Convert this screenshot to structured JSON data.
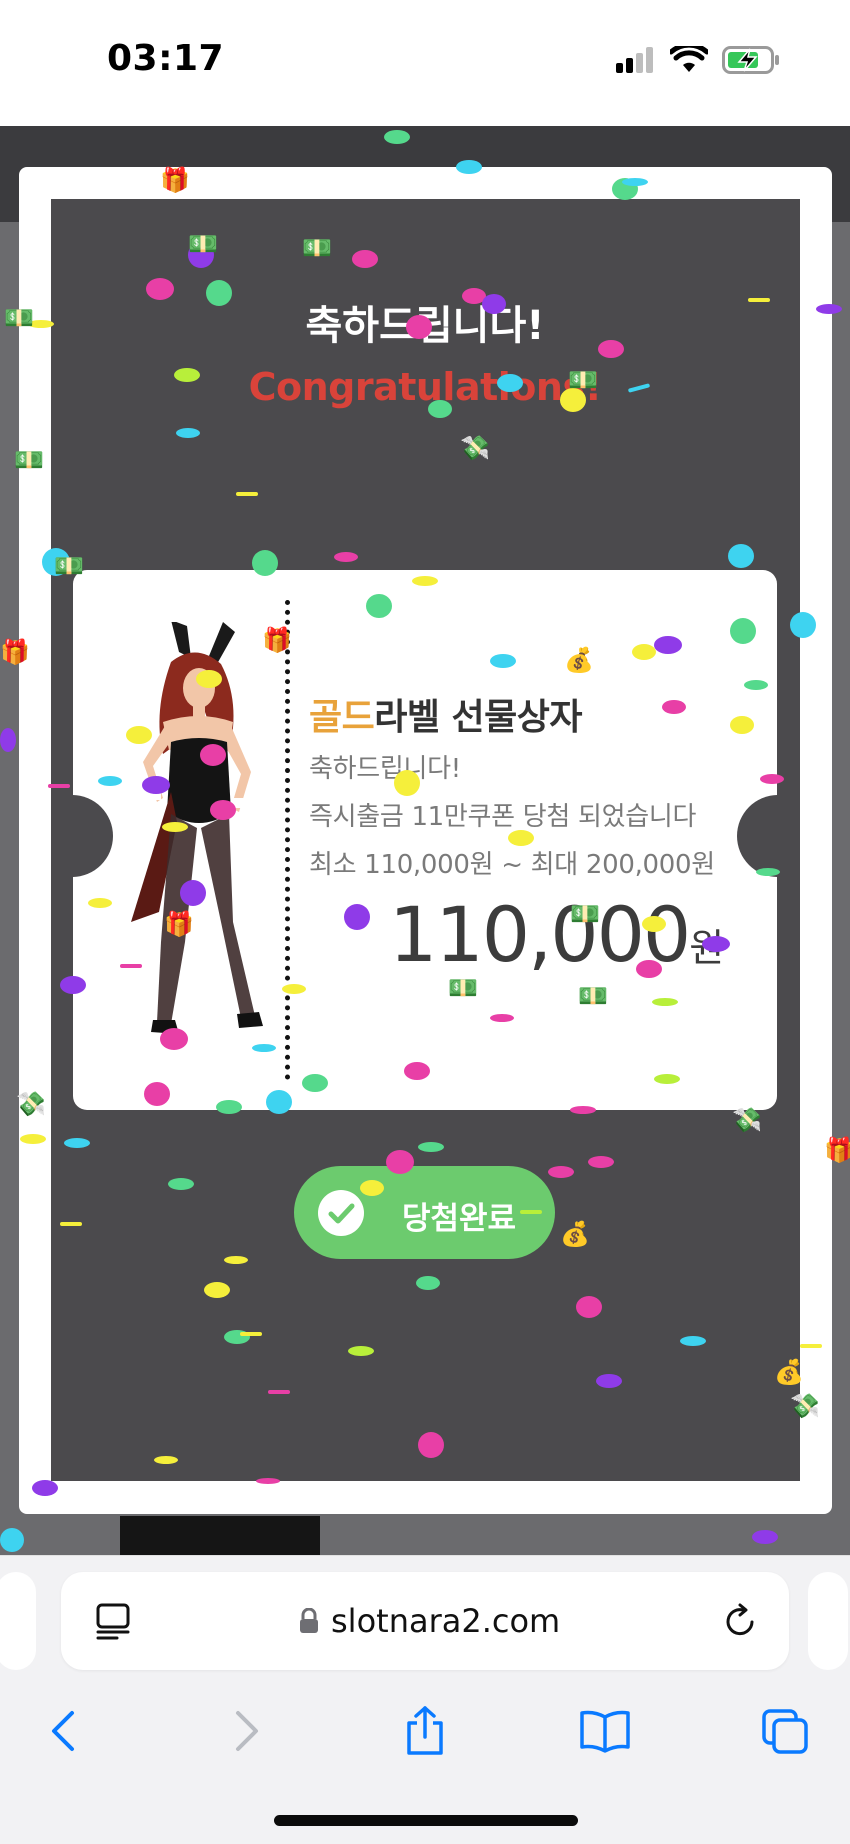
{
  "status_bar": {
    "time": "03:17"
  },
  "modal": {
    "title_ko": "축하드립니다!",
    "title_en": "Congratulations!"
  },
  "ticket": {
    "title_highlight": "골드",
    "title_rest": "라벨 선물상자",
    "line1": "축하드립니다!",
    "line2": "즉시출금 11만쿠폰 당첨 되었습니다",
    "line3": "최소 110,000원 ~ 최대 200,000원",
    "amount": "110,000",
    "currency": "원"
  },
  "claim_button": {
    "label": "당첨완료"
  },
  "browser": {
    "url": "slotnara2.com"
  },
  "colors": {
    "gold": "#e8a23a",
    "congrats_red": "#d9433a",
    "button_green": "#6ccb6e",
    "modal_bg": "#4b4a4d"
  }
}
